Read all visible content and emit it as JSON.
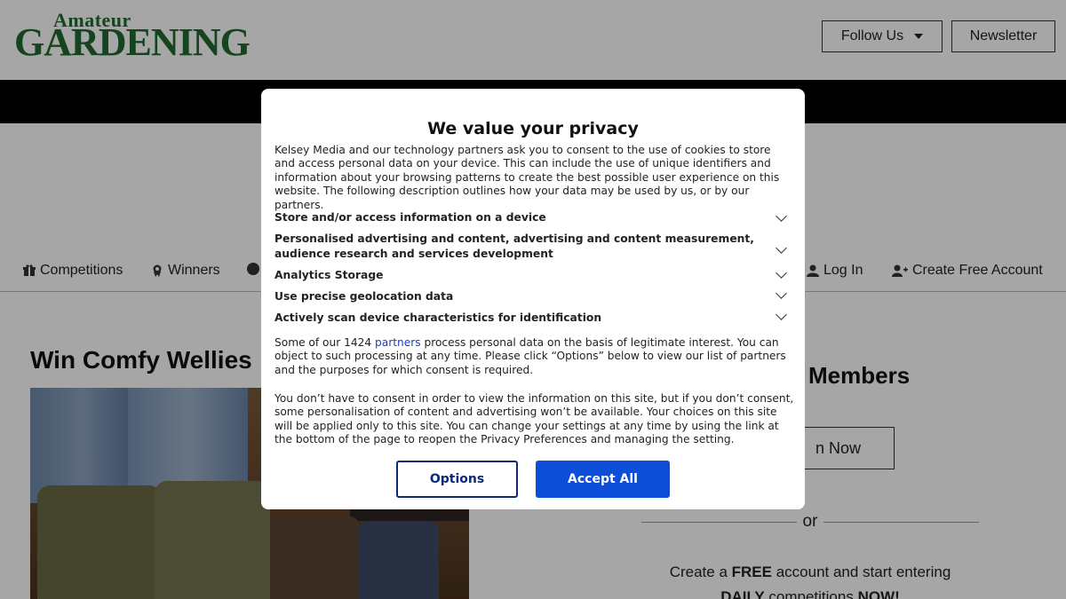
{
  "header": {
    "logo_top": "Amateur",
    "logo_main": "GARDENING",
    "follow_label": "Follow Us",
    "newsletter_label": "Newsletter"
  },
  "nav": {
    "items": [
      {
        "label": "Competitions",
        "icon": "gift-icon"
      },
      {
        "label": "Winners",
        "icon": "award-icon"
      },
      {
        "label": "Log In",
        "icon": "user-icon"
      },
      {
        "label": "Create Free Account",
        "icon": "user-plus-icon"
      }
    ]
  },
  "main": {
    "title": "Win Comfy Wellies",
    "members_title": "Members",
    "join_label": "n Now",
    "or_text": "or",
    "create_pre": "Create a ",
    "create_free": "FREE",
    "create_post": " account and start entering",
    "create_daily": "DAILY",
    "create_comps": " competitions ",
    "create_now": "NOW!"
  },
  "consent": {
    "title": "We value your privacy",
    "intro": "Kelsey Media and our technology partners ask you to consent to the use of cookies to store and access personal data on your device. This can include the use of unique identifiers and information about your browsing patterns to create the best possible user experience on this website. The following description outlines how your data may be used by us, or by our partners.",
    "purposes": [
      "Store and/or access information on a device",
      "Personalised advertising and content, advertising and content measurement, audience research and services development",
      "Analytics Storage",
      "Use precise geolocation data",
      "Actively scan device characteristics for identification"
    ],
    "p2_pre": "Some of our 1424 ",
    "p2_link": "partners",
    "p2_post": " process personal data on the basis of legitimate interest. You can object to such processing at any time. Please click “Options” below to view our list of partners and the purposes for which consent is required.",
    "p3": "You don’t have to consent in order to view the information on this site, but if you don’t consent, some personalisation of content and advertising won’t be available. Your choices on this site will be applied only to this site. You can change your settings at any time by using the link at the bottom of the page to reopen the Privacy Preferences and managing the setting.",
    "options_label": "Options",
    "accept_label": "Accept All"
  },
  "colors": {
    "brand_green": "#1f6b2f",
    "accept_blue": "#0d4ed8",
    "options_navy": "#0b2b78"
  }
}
